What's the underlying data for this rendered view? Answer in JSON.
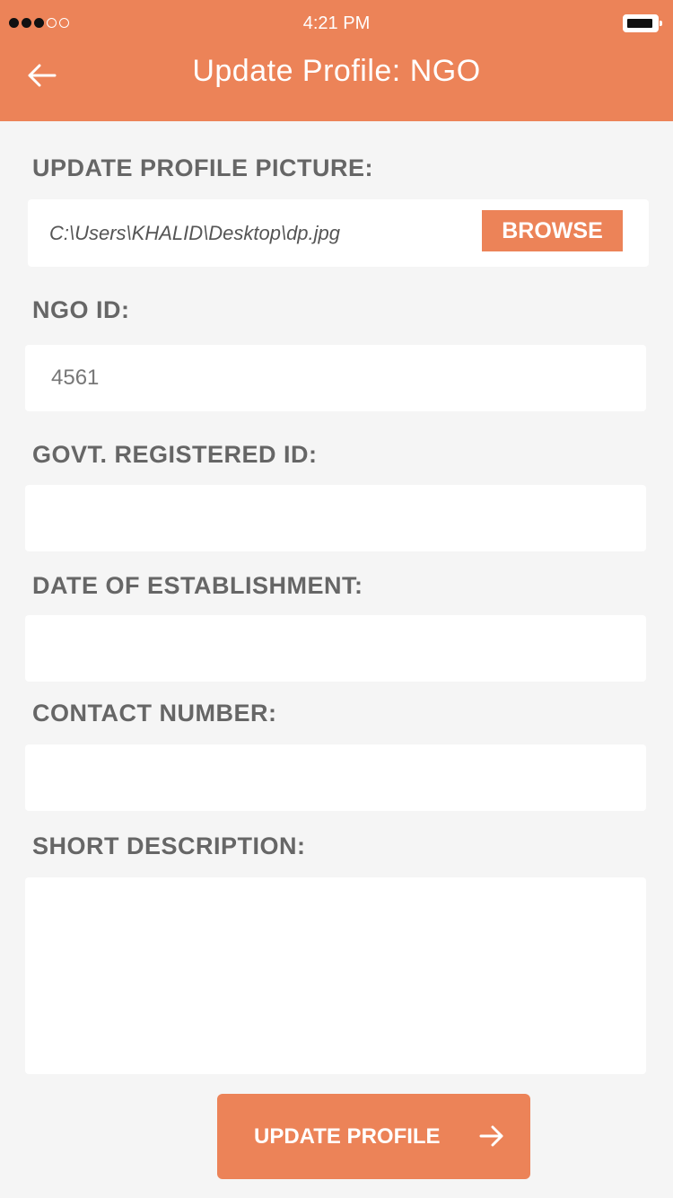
{
  "status_bar": {
    "time": "4:21 PM",
    "signal_icon": "signal-dots-icon",
    "battery_icon": "battery-icon"
  },
  "header": {
    "back_icon": "arrow-left-icon",
    "title": "Update Profile: NGO",
    "background_color": "#ec8358"
  },
  "form": {
    "profile_picture": {
      "label": "UPDATE PROFILE PICTURE:",
      "file_path": "C:\\Users\\KHALID\\Desktop\\dp.jpg",
      "browse_label": "BROWSE"
    },
    "ngo_id": {
      "label": "NGO ID:",
      "value": "4561"
    },
    "govt_registered_id": {
      "label": "GOVT. REGISTERED ID:",
      "value": ""
    },
    "date_of_establishment": {
      "label": "DATE OF ESTABLISHMENT:",
      "value": ""
    },
    "contact_number": {
      "label": "CONTACT NUMBER:",
      "value": ""
    },
    "short_description": {
      "label": "SHORT DESCRIPTION:",
      "value": ""
    }
  },
  "submit": {
    "label": "UPDATE PROFILE",
    "icon": "arrow-right-icon"
  }
}
